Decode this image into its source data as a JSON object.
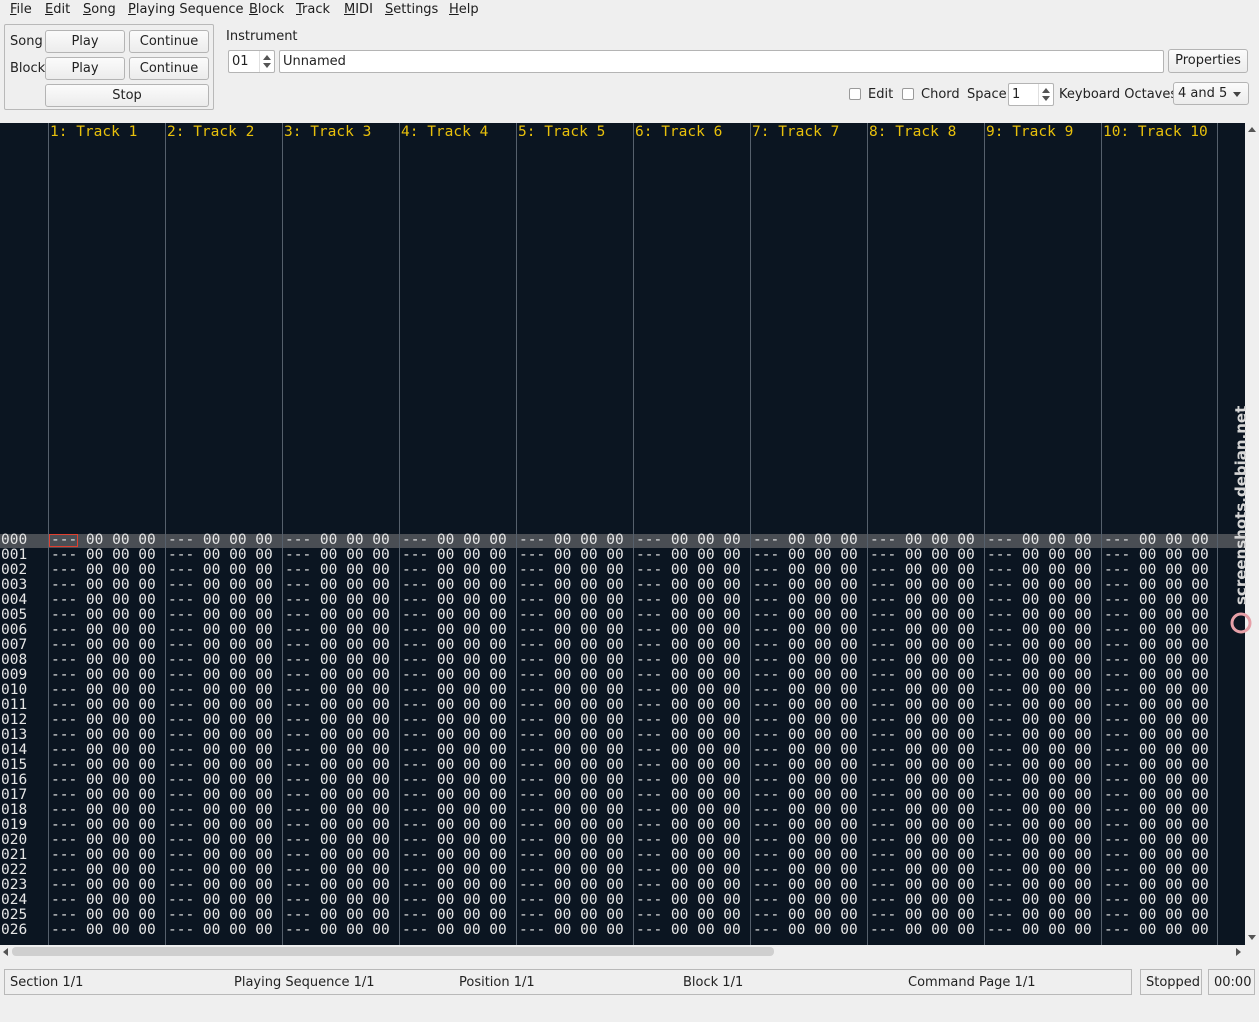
{
  "menu": [
    "File",
    "Edit",
    "Song",
    "Playing Sequence",
    "Block",
    "Track",
    "MIDI",
    "Settings",
    "Help"
  ],
  "controls": {
    "song_label": "Song",
    "block_label": "Block",
    "play": "Play",
    "continue": "Continue",
    "stop": "Stop"
  },
  "instrument": {
    "title": "Instrument",
    "number": "01",
    "name": "Unnamed",
    "properties": "Properties"
  },
  "options": {
    "edit": "Edit",
    "chord": "Chord",
    "space_label": "Space",
    "space_value": "1",
    "keyboard_label": "Keyboard Octaves",
    "keyboard_value": "4 and 5"
  },
  "tracks": [
    "1: Track 1",
    "2: Track 2",
    "3: Track 3",
    "4: Track 4",
    "5: Track 5",
    "6: Track 6",
    "7: Track 7",
    "8: Track 8",
    "9: Track 9",
    "10: Track 10"
  ],
  "rows": [
    "000",
    "001",
    "002",
    "003",
    "004",
    "005",
    "006",
    "007",
    "008",
    "009",
    "010",
    "011",
    "012",
    "013",
    "014",
    "015",
    "016",
    "017",
    "018",
    "019",
    "020",
    "021",
    "022",
    "023",
    "024",
    "025",
    "026"
  ],
  "cell_text": "--- 00 00 00",
  "status": {
    "section": "Section 1/1",
    "playseq": "Playing Sequence 1/1",
    "position": "Position 1/1",
    "block": "Block 1/1",
    "cmdpage": "Command Page 1/1",
    "state": "Stopped",
    "time": "00:00"
  },
  "colors": {
    "tracker_bg": "#0b1521",
    "track_header": "#e8c00c",
    "cursor": "#e04030"
  }
}
